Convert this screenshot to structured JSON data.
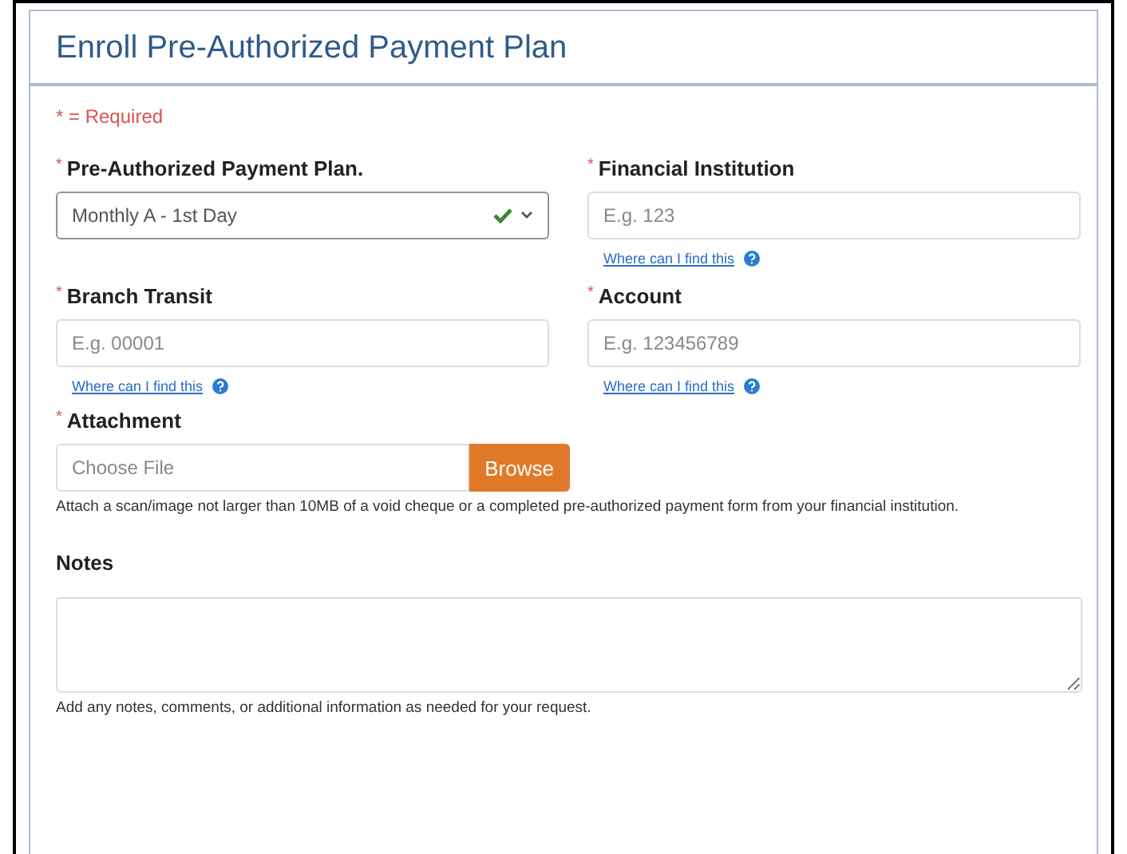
{
  "title": "Enroll Pre-Authorized Payment Plan",
  "required_note": "* = Required",
  "fields": [
    {
      "kind": "select",
      "label": "Pre-Authorized Payment Plan.",
      "mark": "*",
      "value": "Monthly A - 1st Day",
      "valid": true
    },
    {
      "kind": "text",
      "label": "Financial Institution",
      "mark": "*",
      "placeholder": "E.g. 123",
      "help": "Where can I find this"
    },
    {
      "kind": "text",
      "label": "Branch Transit",
      "mark": "*",
      "placeholder": "E.g. 00001",
      "help": "Where can I find this"
    },
    {
      "kind": "text",
      "label": "Account",
      "mark": "*",
      "placeholder": "E.g. 123456789",
      "help": "Where can I find this"
    }
  ],
  "attachment": {
    "label": "Attachment",
    "mark": "*",
    "placeholder": "Choose File",
    "button": "Browse",
    "hint": "Attach a scan/image not larger than 10MB of a void cheque or a completed pre-authorized payment form from your financial institution."
  },
  "notes": {
    "label": "Notes",
    "hint": "Add any notes, comments, or additional information as needed for your request."
  }
}
